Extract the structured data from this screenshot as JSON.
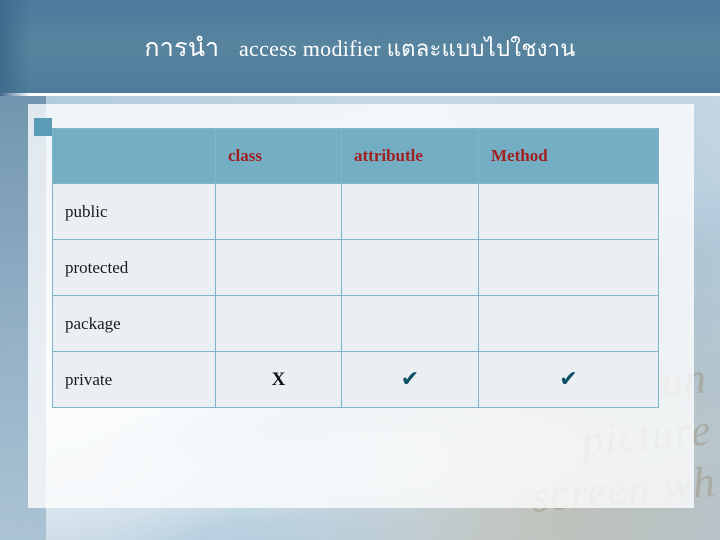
{
  "slide": {
    "title_thai": "การนำ",
    "title_english": "access modifier แตละแบบไปใชงาน",
    "bullet_marker": "square-bullet"
  },
  "table": {
    "headers": [
      "",
      "class",
      "attributle",
      "Method"
    ],
    "rows": [
      {
        "label": "public",
        "class": "",
        "attributle": "",
        "method": ""
      },
      {
        "label": "protected",
        "class": "",
        "attributle": "",
        "method": ""
      },
      {
        "label": "package",
        "class": "",
        "attributle": "",
        "method": ""
      },
      {
        "label": "private",
        "class": "X",
        "attributle": "✔",
        "method": "✔"
      }
    ]
  },
  "colors": {
    "header_band": "#4f7d9d",
    "table_header_bg": "#74aec4",
    "table_header_text": "#a02020",
    "cell_bg": "#e9eff2",
    "grid_line": "#7fb4c9",
    "bullet": "#5b9bb5"
  },
  "background": {
    "watermark_line1": "dun",
    "watermark_line2": "picture",
    "watermark_line3": "screen wh"
  }
}
